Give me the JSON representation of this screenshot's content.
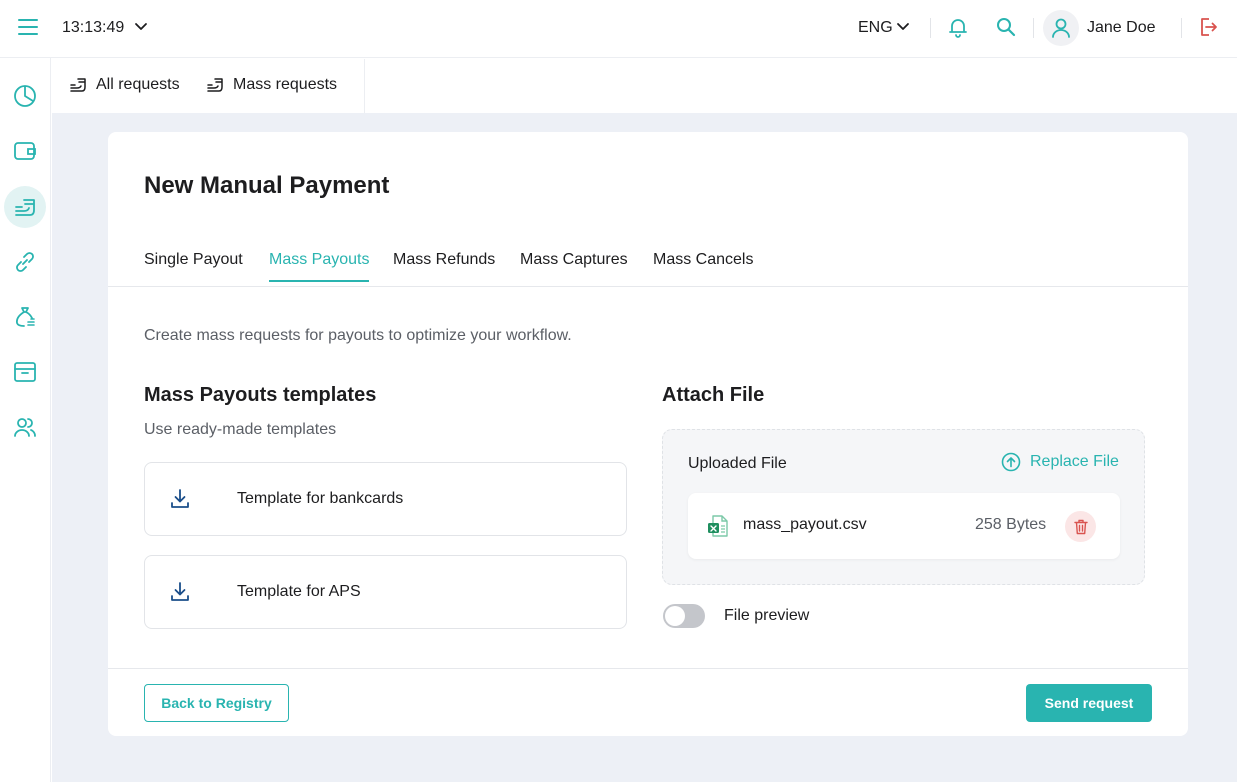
{
  "topbar": {
    "time": "13:13:49",
    "language": "ENG",
    "user_name": "Jane Doe"
  },
  "subnav": {
    "items": [
      {
        "label": "All requests"
      },
      {
        "label": "Mass requests"
      }
    ]
  },
  "page": {
    "title": "New Manual Payment",
    "tabs": [
      {
        "label": "Single Payout",
        "active": false
      },
      {
        "label": "Mass Payouts",
        "active": true
      },
      {
        "label": "Mass Refunds",
        "active": false
      },
      {
        "label": "Mass Captures",
        "active": false
      },
      {
        "label": "Mass Cancels",
        "active": false
      }
    ],
    "description": "Create mass requests for payouts to optimize your workflow."
  },
  "templates": {
    "heading": "Mass Payouts templates",
    "subheading": "Use ready-made templates",
    "items": [
      {
        "label": "Template for bankcards"
      },
      {
        "label": "Template for APS"
      }
    ]
  },
  "attach": {
    "heading": "Attach File",
    "uploaded_label": "Uploaded File",
    "replace_label": "Replace File",
    "file": {
      "name": "mass_payout.csv",
      "size": "258 Bytes"
    },
    "preview_label": "File preview",
    "preview_enabled": false
  },
  "actions": {
    "back_label": "Back to Registry",
    "send_label": "Send request"
  },
  "colors": {
    "accent": "#29b4b0",
    "danger": "#d9534f",
    "background": "#edf0f6"
  }
}
